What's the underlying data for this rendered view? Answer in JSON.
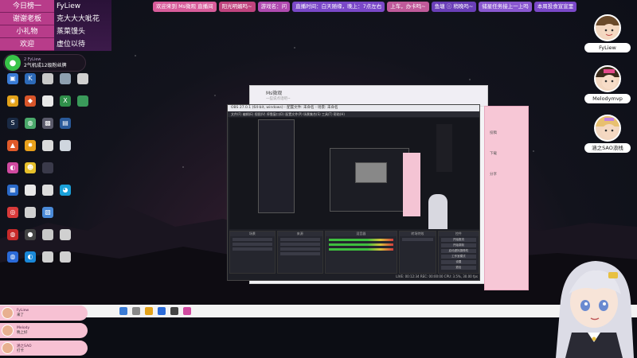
{
  "info_board": {
    "rows": [
      {
        "label": "今日榜一",
        "value": "FyLiew"
      },
      {
        "label": "谢谢老板",
        "value": "克大大大呲花"
      },
      {
        "label": "小礼物",
        "value": "蒸菜馒头"
      },
      {
        "label": "欢迎",
        "value": "虚位以待"
      }
    ]
  },
  "fan_badge": {
    "icon": "wechat-icon",
    "sub": "2 FyLiew",
    "text": "2气机成12级粉丝牌"
  },
  "marquee": [
    "欢迎来到 Ms微观 直播间",
    "阳光明媚吗~",
    "游戏名：问",
    "直播时间：白天随缘，晚上：7点左右",
    "上车，办卡吗~",
    "鱼塘 ⓘ 稍晚吗~",
    "储星任务接上一上吗",
    "本周投食宣宣里"
  ],
  "viewers": [
    {
      "name": "FyLiew"
    },
    {
      "name": "Melodymvp"
    },
    {
      "name": "涵之SAO浪栈"
    }
  ],
  "chat_window": {
    "title": "Ms微观",
    "subtitle": "一些说点话吧~"
  },
  "obs": {
    "title": "OBS 27.0.1 (64-bit, windows) - 配置文件: 未命名 - 场景: 未命名",
    "menu": "文件(F)  编辑(E)  视图(V)  停靠窗口(D)  配置文件(P)  场景集合(S)  工具(T)  帮助(H)",
    "docks": {
      "scenes": "场景",
      "sources": "来源",
      "mixer": "混音器",
      "transitions": "转场特效",
      "controls": "控件"
    },
    "controls": [
      "开始推流",
      "开始录制",
      "启动虚拟摄像机",
      "工作室模式",
      "设置",
      "退出"
    ],
    "status": "LIVE: 00:12:34  REC: 00:00:00  CPU: 3.5%, 30.00 fps"
  },
  "chat_messages": [
    {
      "name": "FyLiew",
      "text": "来了"
    },
    {
      "name": "Melody",
      "text": "晚上好"
    },
    {
      "name": "涵之SAO",
      "text": "打卡"
    }
  ],
  "pink_panel_labels": [
    "投稿",
    "下载",
    "分享"
  ]
}
